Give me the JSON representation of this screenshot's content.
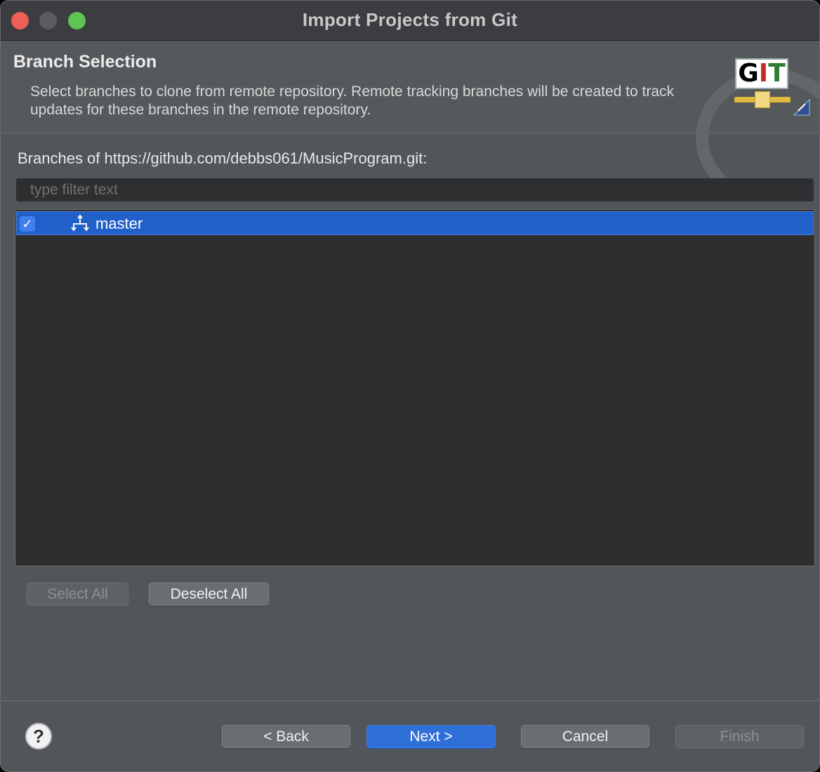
{
  "window": {
    "title": "Import Projects from Git"
  },
  "header": {
    "title": "Branch Selection",
    "description": "Select branches to clone from remote repository. Remote tracking branches will be created to track updates for these branches in the remote repository.",
    "logo_text": "GIT"
  },
  "content": {
    "branches_label": "Branches of https://github.com/debbs061/MusicProgram.git:",
    "filter_placeholder": "type filter text",
    "filter_value": "",
    "branches": [
      {
        "name": "master",
        "checked": true,
        "selected": true
      }
    ]
  },
  "selection_buttons": {
    "select_all": "Select All",
    "deselect_all": "Deselect All"
  },
  "footer": {
    "help": "?",
    "back": "< Back",
    "next": "Next >",
    "cancel": "Cancel",
    "finish": "Finish"
  },
  "colors": {
    "selection": "#2060c8",
    "primary_button": "#2f6fd8",
    "close": "#ee5f57",
    "maximize": "#5fc453"
  }
}
